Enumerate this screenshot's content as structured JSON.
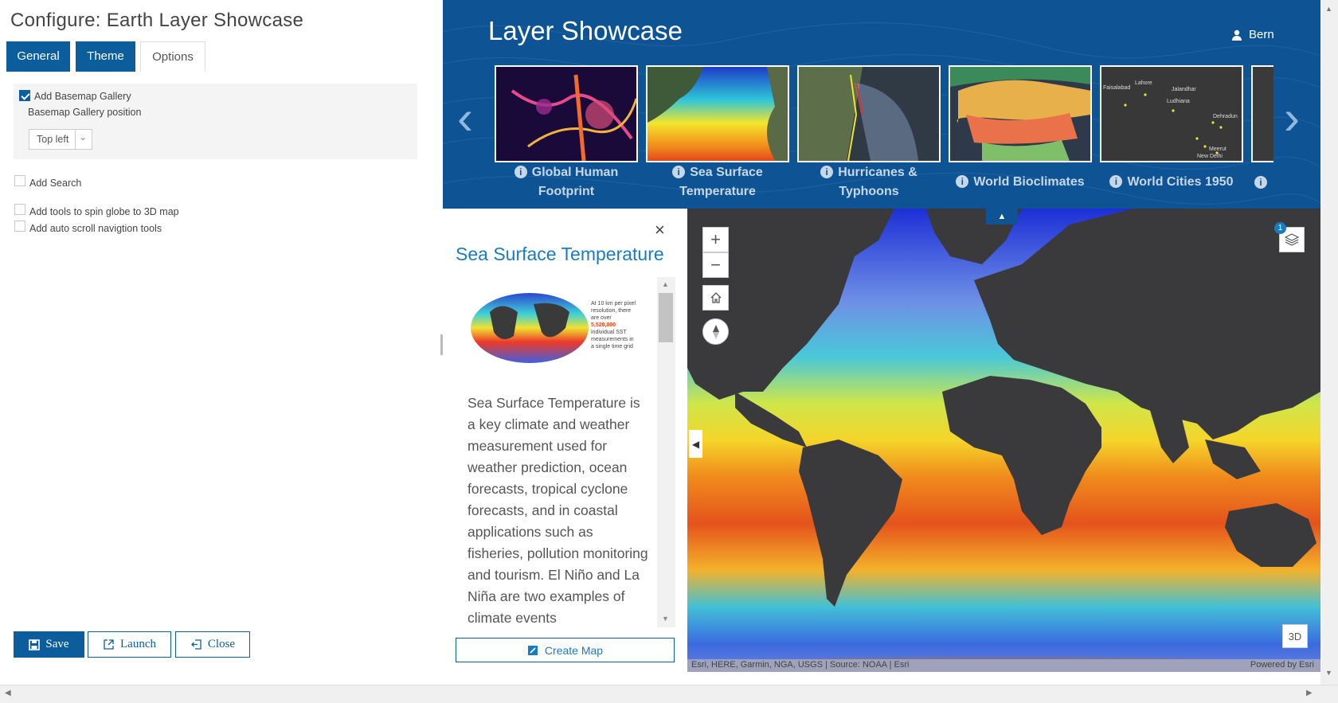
{
  "config": {
    "title": "Configure: Earth Layer Showcase",
    "tabs": [
      "General",
      "Theme",
      "Options"
    ],
    "options": {
      "basemap_gallery": "Add Basemap Gallery",
      "basemap_position_label": "Basemap Gallery position",
      "basemap_position_value": "Top left",
      "search": "Add Search",
      "spin_globe": "Add tools to spin globe to 3D map",
      "auto_scroll": "Add auto scroll navigtion tools"
    },
    "buttons": {
      "save": "Save",
      "launch": "Launch",
      "close": "Close"
    }
  },
  "header": {
    "title": "Layer Showcase",
    "user": "Bern",
    "layers": [
      {
        "line1": "Global Human",
        "line2": "Footprint"
      },
      {
        "line1": "Sea Surface",
        "line2": "Temperature"
      },
      {
        "line1": "Hurricanes &",
        "line2": "Typhoons"
      },
      {
        "line1": "World Bioclimates",
        "line2": ""
      },
      {
        "line1": "World Cities 1950",
        "line2": ""
      }
    ],
    "city_labels": [
      "Faisalabad",
      "Lahore",
      "Jalandhar",
      "Ludhiana",
      "Dehradun",
      "Meerut",
      "New Delhi"
    ]
  },
  "details": {
    "title": "Sea Surface Temperature",
    "infographic": {
      "line1": "At 10 km per pixel",
      "line2": "resolution, there",
      "line3": "are over",
      "number": "5,520,000",
      "line4": "individual SST",
      "line5": "measurements in",
      "line6": "a single time grid"
    },
    "body": "Sea Surface Temperature is a key climate and weather measurement used for weather prediction, ocean forecasts, tropical cyclone forecasts, and in coastal applications such as fisheries, pollution monitoring and tourism. El Niño and La Niña are two examples of climate events",
    "create_map": "Create Map"
  },
  "map": {
    "layer_badge": "1",
    "view_3d": "3D",
    "attribution": "Esri, HERE, Garmin, NGA, USGS | Source: NOAA | Esri",
    "powered": "Powered by Esri"
  }
}
